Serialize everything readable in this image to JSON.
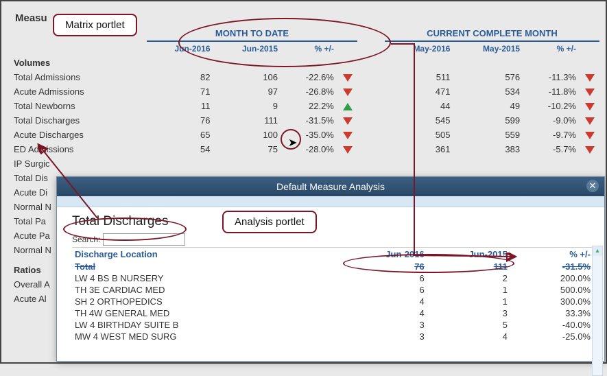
{
  "page_title_visible": "Measu",
  "annotations": {
    "matrix_portlet": "Matrix portlet",
    "analysis_portlet": "Analysis portlet",
    "total_discharges": "Total Discharges"
  },
  "groups": {
    "mtd": {
      "title": "MONTH TO DATE",
      "cols": [
        "Jun-2016",
        "Jun-2015",
        "% +/-"
      ]
    },
    "ccm": {
      "title": "CURRENT COMPLETE MONTH",
      "cols": [
        "May-2016",
        "May-2015",
        "% +/-"
      ]
    }
  },
  "sections": [
    {
      "label": "Volumes",
      "is_header": true
    },
    {
      "label": "Total Admissions",
      "mtd": [
        "82",
        "106",
        "-22.6%",
        "down"
      ],
      "ccm": [
        "511",
        "576",
        "-11.3%",
        "down"
      ]
    },
    {
      "label": "Acute Admissions",
      "mtd": [
        "71",
        "97",
        "-26.8%",
        "down"
      ],
      "ccm": [
        "471",
        "534",
        "-11.8%",
        "down"
      ]
    },
    {
      "label": "Total Newborns",
      "mtd": [
        "11",
        "9",
        "22.2%",
        "up"
      ],
      "ccm": [
        "44",
        "49",
        "-10.2%",
        "down"
      ]
    },
    {
      "label": "Total Discharges",
      "mtd": [
        "76",
        "111",
        "-31.5%",
        "down"
      ],
      "ccm": [
        "545",
        "599",
        "-9.0%",
        "down"
      ]
    },
    {
      "label": "Acute Discharges",
      "mtd": [
        "65",
        "100",
        "-35.0%",
        "down"
      ],
      "ccm": [
        "505",
        "559",
        "-9.7%",
        "down"
      ]
    },
    {
      "label": "ED Admissions",
      "mtd": [
        "54",
        "75",
        "-28.0%",
        "down"
      ],
      "ccm": [
        "361",
        "383",
        "-5.7%",
        "down"
      ]
    },
    {
      "label": "IP Surgic",
      "truncated": true
    },
    {
      "label": "Total Dis",
      "truncated": true
    },
    {
      "label": "Acute Di",
      "truncated": true
    },
    {
      "label": "Normal N",
      "truncated": true
    },
    {
      "label": "Total Pa",
      "truncated": true
    },
    {
      "label": "Acute Pa",
      "truncated": true
    },
    {
      "label": "Normal N",
      "truncated": true
    },
    {
      "label": "",
      "spacer": true
    },
    {
      "label": "Ratios",
      "is_header": true
    },
    {
      "label": "Overall A",
      "truncated": true
    },
    {
      "label": "Acute Al",
      "truncated": true
    }
  ],
  "dialog": {
    "title": "Default Measure Analysis",
    "measure": "Total Discharges",
    "search_label": "Search:",
    "headers": [
      "Discharge Location",
      "Jun-2016",
      "Jun-2015",
      "% +/-"
    ],
    "total_row": [
      "Total",
      "76",
      "111",
      "-31.5%"
    ],
    "rows": [
      [
        "LW 4 BS B NURSERY",
        "6",
        "2",
        "200.0%"
      ],
      [
        "TH 3E CARDIAC MED",
        "6",
        "1",
        "500.0%"
      ],
      [
        "SH 2 ORTHOPEDICS",
        "4",
        "1",
        "300.0%"
      ],
      [
        "TH 4W GENERAL MED",
        "4",
        "3",
        "33.3%"
      ],
      [
        "LW 4 BIRTHDAY SUITE B",
        "3",
        "5",
        "-40.0%"
      ],
      [
        "MW 4 WEST MED SURG",
        "3",
        "4",
        "-25.0%"
      ]
    ]
  },
  "chart_data": {
    "type": "table",
    "title": "Default Measure Analysis — Total Discharges",
    "columns": [
      "Discharge Location",
      "Jun-2016",
      "Jun-2015",
      "% +/-"
    ],
    "rows": [
      [
        "Total",
        76,
        111,
        -31.5
      ],
      [
        "LW 4 BS B NURSERY",
        6,
        2,
        200.0
      ],
      [
        "TH 3E CARDIAC MED",
        6,
        1,
        500.0
      ],
      [
        "SH 2 ORTHOPEDICS",
        4,
        1,
        300.0
      ],
      [
        "TH 4W GENERAL MED",
        4,
        3,
        33.3
      ],
      [
        "LW 4 BIRTHDAY SUITE B",
        3,
        5,
        -40.0
      ],
      [
        "MW 4 WEST MED SURG",
        3,
        4,
        -25.0
      ]
    ]
  }
}
